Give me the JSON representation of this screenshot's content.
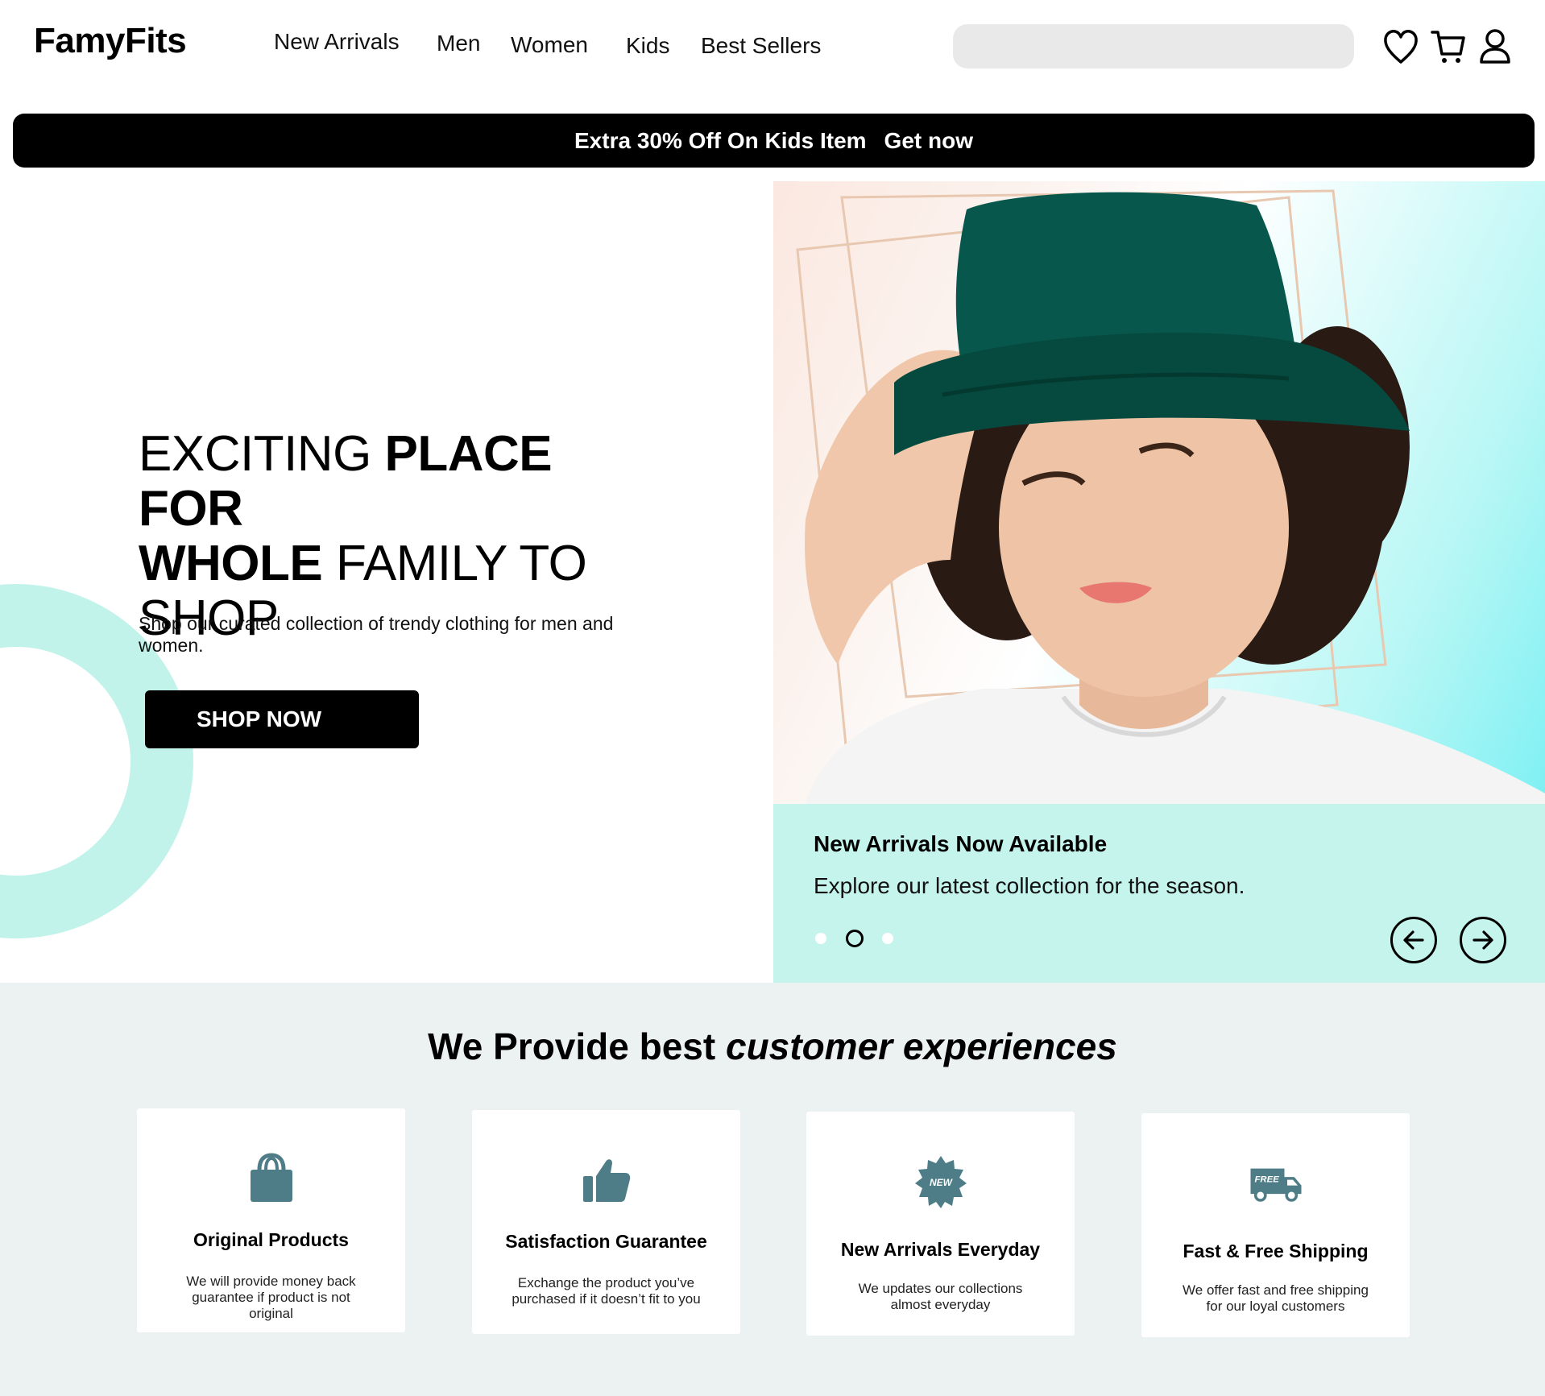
{
  "brand": {
    "name": "FamyFits"
  },
  "nav": {
    "items": [
      {
        "label": "New Arrivals"
      },
      {
        "label": "Men"
      },
      {
        "label": "Women"
      },
      {
        "label": "Kids"
      },
      {
        "label": "Best Sellers"
      }
    ]
  },
  "search": {
    "placeholder": ""
  },
  "header_icons": [
    "heart-icon",
    "cart-icon",
    "user-icon"
  ],
  "promo": {
    "text": "Extra 30% Off On Kids Item",
    "link": "Get now"
  },
  "hero": {
    "headline": {
      "part1": "EXCITING ",
      "part2": "PLACE FOR",
      "part3": "WHOLE",
      "part4": " FAMILY TO",
      "part5": "SHOP"
    },
    "subtitle": "Shop our curated collection of trendy clothing for men and women.",
    "cta": "SHOP NOW"
  },
  "carousel": {
    "title": "New Arrivals Now Available",
    "subtitle": "Explore our latest collection for the season.",
    "slide_count": 3,
    "active_slide": 2
  },
  "features": {
    "title_bold": "We Provide best",
    "title_italic": " customer experiences",
    "cards": [
      {
        "icon": "shopping-bag-icon",
        "title": "Original Products",
        "desc": "We will provide money back guarantee if product is not original"
      },
      {
        "icon": "thumbs-up-icon",
        "title": "Satisfaction Guarantee",
        "desc": "Exchange the product you’ve purchased if it doesn’t fit to you"
      },
      {
        "icon": "new-badge-icon",
        "title": "New Arrivals Everyday",
        "desc": "We updates our collections almost everyday",
        "badge": "NEW"
      },
      {
        "icon": "free-truck-icon",
        "title": "Fast & Free Shipping",
        "desc": "We offer fast and free shipping for our loyal customers",
        "badge": "FREE"
      }
    ]
  },
  "colors": {
    "accent": "#c5f4ec",
    "icon": "#4e7d87",
    "promo_bg": "#000000",
    "section_bg": "#ecf1f1"
  }
}
